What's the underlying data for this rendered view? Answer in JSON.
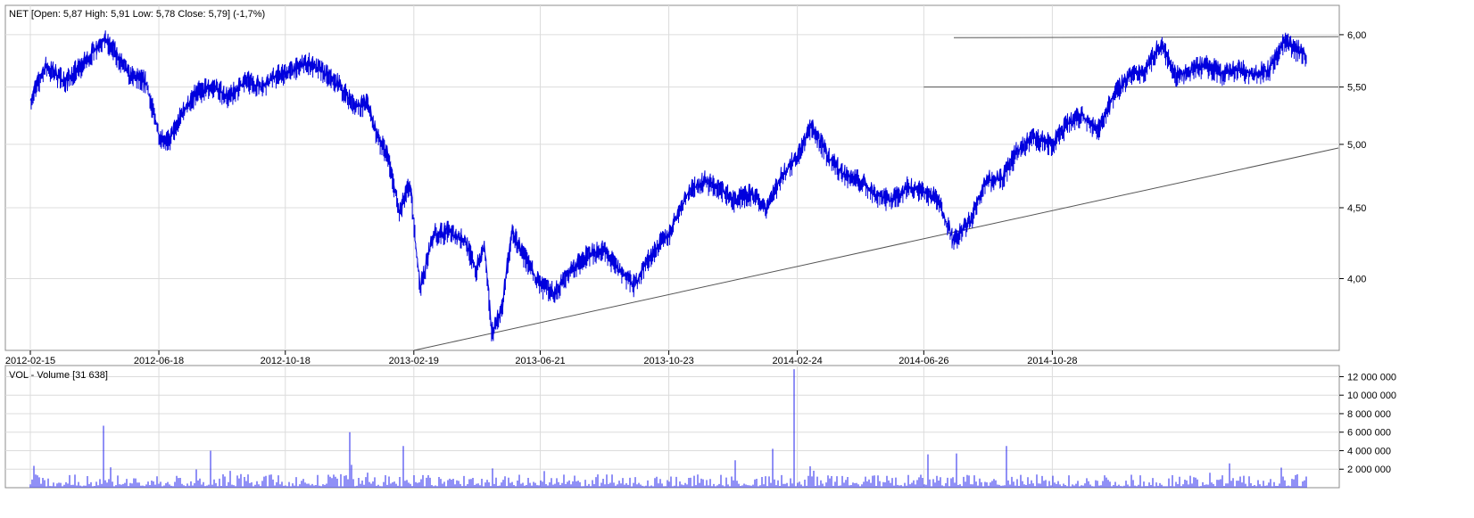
{
  "price_panel": {
    "header": "NET [Open: 5,87  High: 5,91  Low: 5,78  Close: 5,79] (-1,7%)"
  },
  "volume_panel": {
    "header": "VOL - Volume [31 638]"
  },
  "colors": {
    "price": "#0000dd",
    "volume": "#2020ee",
    "trendline": "#555555",
    "grid": "#dcdcdc",
    "frame": "#8c8c8c"
  },
  "chart_data": [
    {
      "type": "ohlc",
      "ticker": "NET",
      "x_tick_labels": [
        "2012-02-15",
        "2012-06-18",
        "2012-10-18",
        "2013-02-19",
        "2013-06-21",
        "2013-10-23",
        "2014-02-24",
        "2014-06-26",
        "2014-10-28"
      ],
      "y_scale": "log",
      "y_tick_values": [
        4.0,
        4.5,
        5.0,
        5.5,
        6.0
      ],
      "y_tick_labels": [
        "4,00",
        "4,50",
        "5,00",
        "5,50",
        "6,00"
      ],
      "ylim": [
        3.55,
        6.3
      ],
      "last_bar": {
        "open": 5.87,
        "high": 5.91,
        "low": 5.78,
        "close": 5.79,
        "change_pct": -1.7
      },
      "close_approx": [
        {
          "d": "2012-02-15",
          "v": 5.38
        },
        {
          "d": "2012-03-01",
          "v": 5.68
        },
        {
          "d": "2012-03-20",
          "v": 5.55
        },
        {
          "d": "2012-04-10",
          "v": 5.75
        },
        {
          "d": "2012-04-25",
          "v": 5.95
        },
        {
          "d": "2012-05-05",
          "v": 5.85
        },
        {
          "d": "2012-05-20",
          "v": 5.6
        },
        {
          "d": "2012-06-05",
          "v": 5.55
        },
        {
          "d": "2012-06-18",
          "v": 5.08
        },
        {
          "d": "2012-06-28",
          "v": 5.02
        },
        {
          "d": "2012-07-10",
          "v": 5.25
        },
        {
          "d": "2012-07-25",
          "v": 5.45
        },
        {
          "d": "2012-08-10",
          "v": 5.5
        },
        {
          "d": "2012-08-25",
          "v": 5.4
        },
        {
          "d": "2012-09-10",
          "v": 5.55
        },
        {
          "d": "2012-09-25",
          "v": 5.5
        },
        {
          "d": "2012-10-10",
          "v": 5.6
        },
        {
          "d": "2012-10-25",
          "v": 5.65
        },
        {
          "d": "2012-11-10",
          "v": 5.72
        },
        {
          "d": "2012-11-25",
          "v": 5.62
        },
        {
          "d": "2012-12-10",
          "v": 5.5
        },
        {
          "d": "2012-12-25",
          "v": 5.32
        },
        {
          "d": "2013-01-05",
          "v": 5.35
        },
        {
          "d": "2013-01-15",
          "v": 5.05
        },
        {
          "d": "2013-01-25",
          "v": 4.9
        },
        {
          "d": "2013-02-05",
          "v": 4.45
        },
        {
          "d": "2013-02-15",
          "v": 4.68
        },
        {
          "d": "2013-02-25",
          "v": 3.92
        },
        {
          "d": "2013-03-10",
          "v": 4.3
        },
        {
          "d": "2013-03-25",
          "v": 4.32
        },
        {
          "d": "2013-04-10",
          "v": 4.25
        },
        {
          "d": "2013-04-20",
          "v": 4.05
        },
        {
          "d": "2013-04-28",
          "v": 4.2
        },
        {
          "d": "2013-05-05",
          "v": 3.65
        },
        {
          "d": "2013-05-15",
          "v": 3.8
        },
        {
          "d": "2013-05-25",
          "v": 4.32
        },
        {
          "d": "2013-06-05",
          "v": 4.15
        },
        {
          "d": "2013-06-21",
          "v": 3.95
        },
        {
          "d": "2013-07-05",
          "v": 3.9
        },
        {
          "d": "2013-07-20",
          "v": 4.05
        },
        {
          "d": "2013-08-05",
          "v": 4.15
        },
        {
          "d": "2013-08-20",
          "v": 4.2
        },
        {
          "d": "2013-09-05",
          "v": 4.05
        },
        {
          "d": "2013-09-20",
          "v": 3.95
        },
        {
          "d": "2013-10-05",
          "v": 4.15
        },
        {
          "d": "2013-10-23",
          "v": 4.3
        },
        {
          "d": "2013-11-10",
          "v": 4.6
        },
        {
          "d": "2013-11-25",
          "v": 4.7
        },
        {
          "d": "2013-12-10",
          "v": 4.65
        },
        {
          "d": "2013-12-25",
          "v": 4.55
        },
        {
          "d": "2014-01-10",
          "v": 4.6
        },
        {
          "d": "2014-01-25",
          "v": 4.5
        },
        {
          "d": "2014-02-10",
          "v": 4.75
        },
        {
          "d": "2014-02-24",
          "v": 4.9
        },
        {
          "d": "2014-03-10",
          "v": 5.15
        },
        {
          "d": "2014-03-25",
          "v": 4.9
        },
        {
          "d": "2014-04-10",
          "v": 4.75
        },
        {
          "d": "2014-04-25",
          "v": 4.7
        },
        {
          "d": "2014-05-10",
          "v": 4.6
        },
        {
          "d": "2014-05-25",
          "v": 4.55
        },
        {
          "d": "2014-06-10",
          "v": 4.65
        },
        {
          "d": "2014-06-26",
          "v": 4.62
        },
        {
          "d": "2014-07-10",
          "v": 4.55
        },
        {
          "d": "2014-07-25",
          "v": 4.25
        },
        {
          "d": "2014-08-10",
          "v": 4.4
        },
        {
          "d": "2014-08-25",
          "v": 4.7
        },
        {
          "d": "2014-09-10",
          "v": 4.72
        },
        {
          "d": "2014-09-25",
          "v": 4.95
        },
        {
          "d": "2014-10-10",
          "v": 5.05
        },
        {
          "d": "2014-10-28",
          "v": 5.0
        },
        {
          "d": "2014-11-10",
          "v": 5.15
        },
        {
          "d": "2014-11-25",
          "v": 5.25
        },
        {
          "d": "2014-12-10",
          "v": 5.1
        },
        {
          "d": "2014-12-25",
          "v": 5.4
        },
        {
          "d": "2015-01-10",
          "v": 5.6
        },
        {
          "d": "2015-01-25",
          "v": 5.65
        },
        {
          "d": "2015-02-10",
          "v": 5.9
        },
        {
          "d": "2015-02-25",
          "v": 5.6
        },
        {
          "d": "2015-03-10",
          "v": 5.65
        },
        {
          "d": "2015-03-25",
          "v": 5.7
        },
        {
          "d": "2015-04-10",
          "v": 5.62
        },
        {
          "d": "2015-04-25",
          "v": 5.65
        },
        {
          "d": "2015-05-10",
          "v": 5.62
        },
        {
          "d": "2015-05-25",
          "v": 5.65
        },
        {
          "d": "2015-06-10",
          "v": 5.95
        },
        {
          "d": "2015-06-20",
          "v": 5.85
        },
        {
          "d": "2015-06-30",
          "v": 5.79
        }
      ],
      "trendlines": [
        {
          "from": {
            "d": "2013-02-19",
            "v": 3.55
          },
          "to": {
            "d": "2015-07-31",
            "v": 4.97
          }
        },
        {
          "from": {
            "d": "2014-07-25",
            "v": 5.97
          },
          "to": {
            "d": "2015-07-31",
            "v": 5.98
          }
        },
        {
          "from": {
            "d": "2014-06-26",
            "v": 5.5
          },
          "to": {
            "d": "2015-07-31",
            "v": 5.5
          }
        }
      ]
    },
    {
      "type": "bar",
      "title": "VOL - Volume",
      "last_value": 31638,
      "y_tick_values": [
        2000000,
        4000000,
        6000000,
        8000000,
        10000000,
        12000000
      ],
      "y_tick_labels": [
        "2 000 000",
        "4 000 000",
        "6 000 000",
        "8 000 000",
        "10 000 000",
        "12 000 000"
      ],
      "ylim": [
        0,
        13200000
      ],
      "spikes": [
        {
          "d": "2012-04-26",
          "v": 6700000
        },
        {
          "d": "2012-12-19",
          "v": 6000000
        },
        {
          "d": "2012-08-08",
          "v": 4000000
        },
        {
          "d": "2013-02-10",
          "v": 4500000
        },
        {
          "d": "2014-02-22",
          "v": 12800000
        },
        {
          "d": "2014-02-01",
          "v": 4200000
        },
        {
          "d": "2014-07-28",
          "v": 3700000
        },
        {
          "d": "2014-09-15",
          "v": 4500000
        },
        {
          "d": "2014-06-30",
          "v": 3600000
        }
      ]
    }
  ]
}
